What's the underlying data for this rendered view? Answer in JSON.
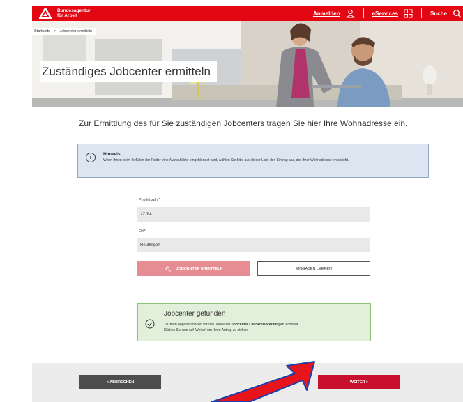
{
  "header": {
    "brand_line1": "Bundesagentur",
    "brand_line2": "für Arbeit",
    "login": "Anmelden",
    "eservices": "eServices",
    "search": "Suche"
  },
  "breadcrumb": {
    "home": "Startseite",
    "separator": ">",
    "current": "Jobcenter ermitteln"
  },
  "hero": {
    "title": "Zuständiges Jobcenter ermitteln"
  },
  "intro": "Zur Ermittlung des für Sie zuständigen Jobcenters tragen Sie hier Ihre Wohnadresse ein.",
  "hint": {
    "icon_glyph": "i",
    "title": "Hinweis",
    "text": "Wenn Ihnen beim Befüllen der Felder eine Auswahlliste eingeblendet wird, wählen Sie bitte aus dieser Liste den Eintrag aus, der Ihrer Wohnadresse entspricht."
  },
  "form": {
    "postal_label": "Postleitzahl*",
    "postal_value": "72764",
    "city_label": "Ort*",
    "city_value": "Reutlingen",
    "search_button": "JOBCENTER ERMITTELN",
    "clear_button": "EINGABEN LEEREN"
  },
  "result": {
    "title": "Jobcenter gefunden",
    "text_before": "Zu Ihren Angaben haben wir das Jobcenter ",
    "jobcenter": "Jobcenter Landkreis Reutlingen",
    "text_after": " ermittelt.",
    "text_line2": "Klicken Sie nun auf 'Weiter' um Ihren Antrag zu stellen."
  },
  "footer": {
    "back_button": "< ABBRECHEN",
    "next_button": "WEITER >"
  },
  "colors": {
    "brand_red": "#e30613",
    "next_red": "#c8102e",
    "search_disabled": "#e58d92",
    "hint_bg": "#dde5f0",
    "success_bg": "#e2f0db",
    "annotation_arrow": "#e8141c"
  }
}
